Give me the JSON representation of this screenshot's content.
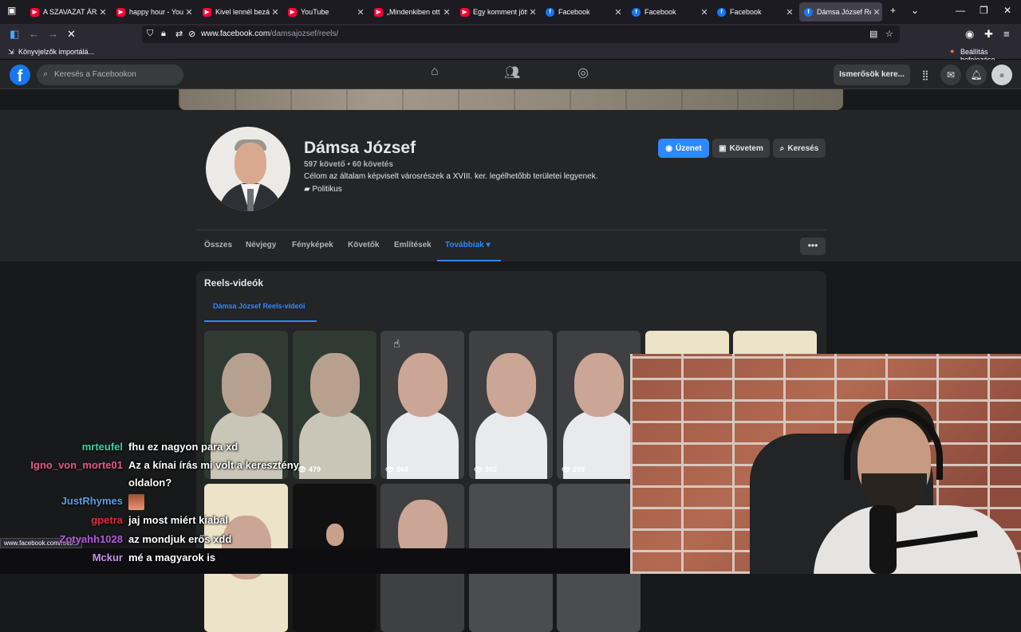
{
  "browser": {
    "tabs": [
      {
        "title": "A SZAVAZAT ÁRA -",
        "icon": "youtube-icon"
      },
      {
        "title": "happy hour - YouTu",
        "icon": "youtube-icon"
      },
      {
        "title": "Kivel lennél bezárva",
        "icon": "youtube-icon"
      },
      {
        "title": "YouTube",
        "icon": "youtube-icon"
      },
      {
        "title": "„Mindenkiben ott e",
        "icon": "youtube-icon"
      },
      {
        "title": "Egy komment jött",
        "icon": "youtube-icon"
      },
      {
        "title": "Facebook",
        "icon": "facebook-icon"
      },
      {
        "title": "Facebook",
        "icon": "facebook-icon"
      },
      {
        "title": "Facebook",
        "icon": "facebook-icon"
      },
      {
        "title": "Dámsa József Reels",
        "icon": "facebook-icon"
      }
    ],
    "url_host": "www.facebook.com",
    "url_path": "/damsajozsef/reels/",
    "bookmark": "Könyvjelzők importálá...",
    "setup_label": "Beállítás befejezése"
  },
  "fb": {
    "search_placeholder": "Keresés a Facebookon",
    "find_friends": "Ismerősök kere..."
  },
  "profile": {
    "name": "Dámsa József",
    "followers": "597 követő • 60 követés",
    "description": "Célom az általam képviselt városrészek a XVIII. ker. legélhetőbb területei legyenek.",
    "category": "Politikus",
    "btn_message": "Üzenet",
    "btn_following": "Követem",
    "btn_search": "Keresés",
    "tabs": [
      "Összes",
      "Névjegy",
      "Fényképek",
      "Követők",
      "Említések",
      "Továbbiak"
    ]
  },
  "reels": {
    "title": "Reels-videók",
    "subtab": "Dámsa József Reels-videói",
    "row1_views": [
      "",
      "479",
      "568",
      "302",
      "259",
      "",
      ""
    ]
  },
  "status_url": "www.facebook.com/reel/...",
  "chat": [
    {
      "user": "mrteufel",
      "color": "#3ad0a0",
      "msg": "fhu ez nagyon para xd"
    },
    {
      "user": "Igno_von_morte01",
      "color": "#e05a8a",
      "msg": "Az a kínai írás mi volt a keresztény"
    },
    {
      "user": "",
      "color": "#ffffff",
      "msg": "oldalon?"
    },
    {
      "user": "JustRhymes",
      "color": "#5a9be8",
      "msg": ""
    },
    {
      "user": "gpetra",
      "color": "#e02a3a",
      "msg": "jaj most miért kiabal"
    },
    {
      "user": "Zotyahh1028",
      "color": "#b05ad8",
      "msg": "az mondjuk erős xdd"
    },
    {
      "user": "Mckur",
      "color": "#c890f0",
      "msg": "mé a magyarok is"
    }
  ]
}
